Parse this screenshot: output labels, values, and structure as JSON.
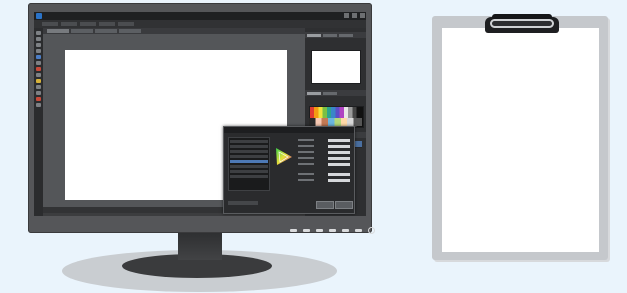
{
  "monitor": {
    "logo_text": "",
    "bezel_buttons": [
      "btn1",
      "btn2",
      "btn3",
      "btn4",
      "btn5",
      "btn6"
    ],
    "power_icon": "power-icon"
  },
  "editor": {
    "menu_items": [
      "",
      "",
      "",
      "",
      "",
      "",
      "",
      "",
      "",
      ""
    ],
    "toolbox_icons": [
      "move-icon",
      "marquee-icon",
      "lasso-icon",
      "crop-icon",
      "brush-icon",
      "eraser-icon",
      "gradient-icon",
      "text-icon",
      "pen-icon",
      "zoom-icon"
    ],
    "canvas_color": "#ffffff",
    "dialog": {
      "title": "",
      "buttons": [
        "",
        ""
      ]
    }
  },
  "clipboard": {
    "paper_color": "#ffffff",
    "board_color": "#c5c8cc",
    "clip_color": "#1e1f21"
  },
  "colors": {
    "background": "#eaf4fc",
    "bezel": "#555659",
    "accent": "#2a73c9"
  }
}
